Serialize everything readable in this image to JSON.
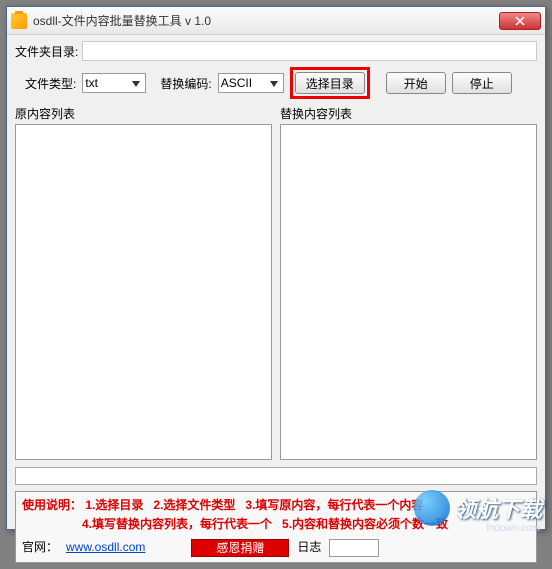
{
  "window": {
    "title": "osdll-文件内容批量替换工具 v 1.0"
  },
  "labels": {
    "folder_dir": "文件夹目录:",
    "file_type": "文件类型:",
    "encoding": "替换编码:",
    "original_list": "原内容列表",
    "replace_list": "替换内容列表"
  },
  "inputs": {
    "dir_value": "",
    "file_type_value": "txt",
    "encoding_value": "ASCII"
  },
  "buttons": {
    "select_dir": "选择目录",
    "start": "开始",
    "stop": "停止",
    "donate": "感恩捐赠"
  },
  "instructions": {
    "prefix": "使用说明：",
    "step1": "1.选择目录",
    "step2": "2.选择文件类型",
    "step3": "3.填写原内容，每行代表一个内容",
    "step4": "4.填写替换内容列表，每行代表一个",
    "step5": "5.内容和替换内容必须个数一致"
  },
  "footer": {
    "official_label": "官网：",
    "official_url": "www.osdll.com",
    "count_label": "日志",
    "count_value": ""
  },
  "watermark": {
    "brand": "领航下载",
    "url": "lhdown.com"
  }
}
